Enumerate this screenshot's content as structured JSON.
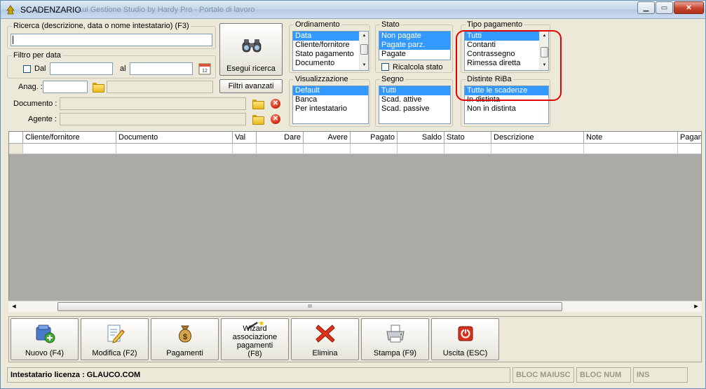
{
  "window": {
    "title": "SCADENZARIO",
    "ghost_title": "Lui Gestione Studio by Hardy Pro - Portale di lavoro",
    "controls": {
      "minimize": "▁",
      "maximize": "▭",
      "close": "✕"
    }
  },
  "search": {
    "legend": "Ricerca (descrizione, data o nome intestatario) (F3)",
    "value": "",
    "button_label": "Esegui ricerca"
  },
  "date_filter": {
    "legend": "Filtro per data",
    "from_label": "Dal",
    "to_label": "al",
    "from_value": "",
    "to_value": ""
  },
  "fields": {
    "anag_label": "Anag. :",
    "anag_value": "",
    "documento_label": "Documento :",
    "agente_label": "Agente :",
    "advanced_filters_label": "Filtri avanzati"
  },
  "ordinamento": {
    "legend": "Ordinamento",
    "items": [
      "Data",
      "Cliente/fornitore",
      "Stato pagamento",
      "Documento"
    ],
    "selected_index": 0
  },
  "stato": {
    "legend": "Stato",
    "items": [
      "Non pagate",
      "Pagate parz.",
      "Pagate"
    ],
    "selected": [
      0,
      1
    ],
    "recalc_label": "Ricalcola stato"
  },
  "tipo_pagamento": {
    "legend": "Tipo pagamento",
    "items": [
      "Tutti",
      "Contanti",
      "Contrassegno",
      "Rimessa diretta"
    ],
    "selected_index": 0
  },
  "visualizzazione": {
    "legend": "Visualizzazione",
    "items": [
      "Default",
      "Banca",
      "Per intestatario"
    ],
    "selected_index": 0
  },
  "segno": {
    "legend": "Segno",
    "items": [
      "Tutti",
      "Scad. attive",
      "Scad. passive"
    ],
    "selected_index": 0
  },
  "distinte": {
    "legend": "Distinte RiBa",
    "items": [
      "Tutte le scadenze",
      "In distinta",
      "Non in distinta"
    ],
    "selected_index": 0
  },
  "grid": {
    "columns": [
      "",
      "Cliente/fornitore",
      "Documento",
      "Val",
      "Dare",
      "Avere",
      "Pagato",
      "Saldo",
      "Stato",
      "Descrizione",
      "Note",
      "Pagam"
    ]
  },
  "hscroll": {
    "thumb_glyph": "III"
  },
  "toolbar": {
    "buttons": [
      {
        "label": "Nuovo (F4)"
      },
      {
        "label": "Modifica (F2)"
      },
      {
        "label": "Pagamenti"
      },
      {
        "label": "Wizard associazione pagamenti (F8)"
      },
      {
        "label": "Elimina"
      },
      {
        "label": "Stampa (F9)"
      },
      {
        "label": "Uscita (ESC)"
      }
    ]
  },
  "status": {
    "license": "Intestatario licenza : GLAUCO.COM",
    "caps": "BLOC MAIUSC",
    "num": "BLOC NUM",
    "ins": "INS"
  },
  "colors": {
    "selection": "#3399ff",
    "highlight_box": "#e30000",
    "grid_bg": "#abaaa7",
    "window_bg": "#ece9d8"
  }
}
